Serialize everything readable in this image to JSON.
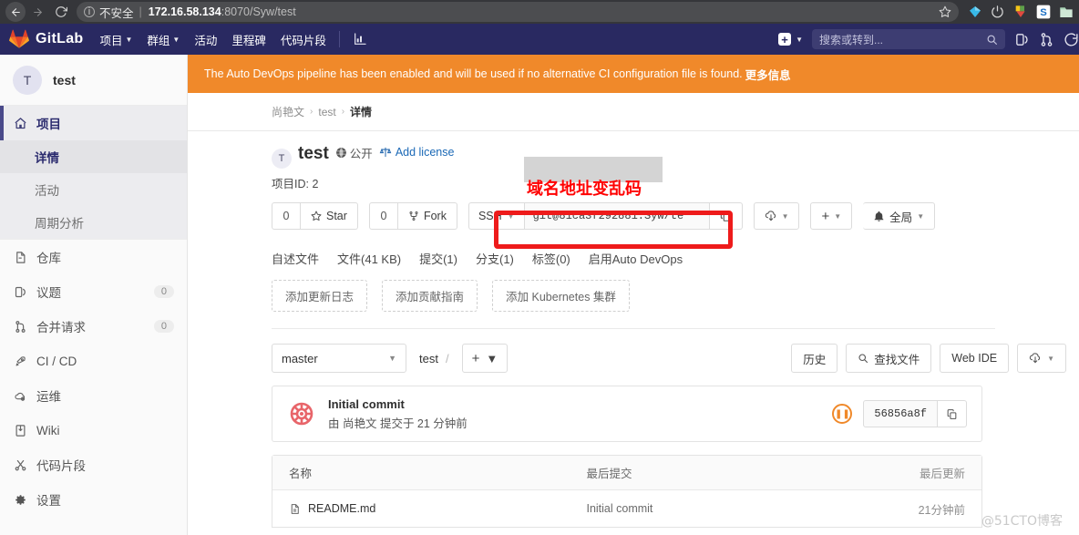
{
  "browser": {
    "back_icon": "back-arrow-icon",
    "forward_icon": "forward-arrow-icon",
    "reload_icon": "reload-icon",
    "security_label": "不安全",
    "url_host": "172.16.58.134",
    "url_rest": ":8070/Syw/test",
    "bookmark_icon": "star-icon",
    "extensions": [
      "diamond-extension-icon",
      "power-extension-icon",
      "download-extension-icon",
      "s-extension-icon",
      "folder-extension-icon"
    ]
  },
  "topnav": {
    "brand": "GitLab",
    "brand_icon": "gitlab-tanuki-icon",
    "items": [
      {
        "label": "项目",
        "has_caret": true
      },
      {
        "label": "群组",
        "has_caret": true
      },
      {
        "label": "活动",
        "has_caret": false
      },
      {
        "label": "里程碑",
        "has_caret": false
      },
      {
        "label": "代码片段",
        "has_caret": false
      }
    ],
    "analytics_icon": "chart-icon",
    "plus_icon": "plus-icon",
    "search_placeholder": "搜索或转到...",
    "search_icon": "search-icon",
    "issues_icon": "issues-icon",
    "merge_requests_icon": "merge-request-icon",
    "todos_icon": "todos-icon"
  },
  "sidebar": {
    "project_initial": "T",
    "project_name": "test",
    "items": [
      {
        "label": "项目",
        "icon": "home-icon",
        "active": true,
        "badge": null
      },
      {
        "label": "仓库",
        "icon": "repository-icon",
        "active": false,
        "badge": null
      },
      {
        "label": "议题",
        "icon": "issues-icon",
        "active": false,
        "badge": "0"
      },
      {
        "label": "合并请求",
        "icon": "merge-request-icon",
        "active": false,
        "badge": "0"
      },
      {
        "label": "CI / CD",
        "icon": "rocket-icon",
        "active": false,
        "badge": null
      },
      {
        "label": "运维",
        "icon": "cloud-gear-icon",
        "active": false,
        "badge": null
      },
      {
        "label": "Wiki",
        "icon": "book-icon",
        "active": false,
        "badge": null
      },
      {
        "label": "代码片段",
        "icon": "scissors-icon",
        "active": false,
        "badge": null
      },
      {
        "label": "设置",
        "icon": "gear-icon",
        "active": false,
        "badge": null
      }
    ],
    "sub_items": [
      {
        "label": "详情",
        "selected": true
      },
      {
        "label": "活动",
        "selected": false
      },
      {
        "label": "周期分析",
        "selected": false
      }
    ]
  },
  "alert": {
    "text": "The Auto DevOps pipeline has been enabled and will be used if no alternative CI configuration file is found.",
    "link": "更多信息"
  },
  "breadcrumb": {
    "items": [
      "尚艳文",
      "test"
    ],
    "current": "详情",
    "separator": "›"
  },
  "project": {
    "initial": "T",
    "name": "test",
    "visibility": "公开",
    "visibility_icon": "globe-icon",
    "license_label": "Add license",
    "license_icon": "license-balance-icon",
    "id_label": "项目ID:",
    "id_value": "2"
  },
  "actions": {
    "star_count": "0",
    "star_label": "Star",
    "star_icon": "star-icon",
    "fork_count": "0",
    "fork_label": "Fork",
    "fork_icon": "fork-icon",
    "clone_protocol": "SSH",
    "clone_url": "git@81ca3f292881:Syw/te",
    "copy_icon": "copy-icon",
    "download_icon": "download-icon",
    "plus_icon": "plus-icon",
    "notify_label": "全局",
    "notify_icon": "bell-icon"
  },
  "annotation": {
    "text": "域名地址变乱码",
    "box_color": "#ee1b1b",
    "text_color": "#ff0000",
    "mask_color": "#d4d4d4"
  },
  "tabs": [
    {
      "label": "自述文件"
    },
    {
      "label": "文件(41 KB)"
    },
    {
      "label": "提交(1)"
    },
    {
      "label": "分支(1)"
    },
    {
      "label": "标签(0)"
    },
    {
      "label": "启用Auto DevOps"
    }
  ],
  "chips": [
    {
      "label": "添加更新日志"
    },
    {
      "label": "添加贡献指南"
    },
    {
      "label": "添加 Kubernetes 集群"
    }
  ],
  "branch_bar": {
    "branch": "master",
    "path_root": "test",
    "path_sep": "/",
    "plus_icon": "plus-icon",
    "history_label": "历史",
    "find_file_label": "查找文件",
    "find_icon": "search-icon",
    "web_ide_label": "Web IDE",
    "download_icon": "download-icon"
  },
  "commit": {
    "avatar_icon": "identicon-avatar",
    "title": "Initial commit",
    "meta": "由 尚艳文 提交于 21 分钟前",
    "pipeline_status": "pending",
    "pipeline_icon": "pipeline-pending-icon",
    "sha": "56856a8f",
    "copy_icon": "copy-icon"
  },
  "file_table": {
    "headers": [
      "名称",
      "最后提交",
      "最后更新"
    ],
    "rows": [
      {
        "name": "README.md",
        "icon": "file-icon",
        "commit": "Initial commit",
        "updated": "21分钟前"
      }
    ]
  },
  "watermark": "@51CTO博客"
}
